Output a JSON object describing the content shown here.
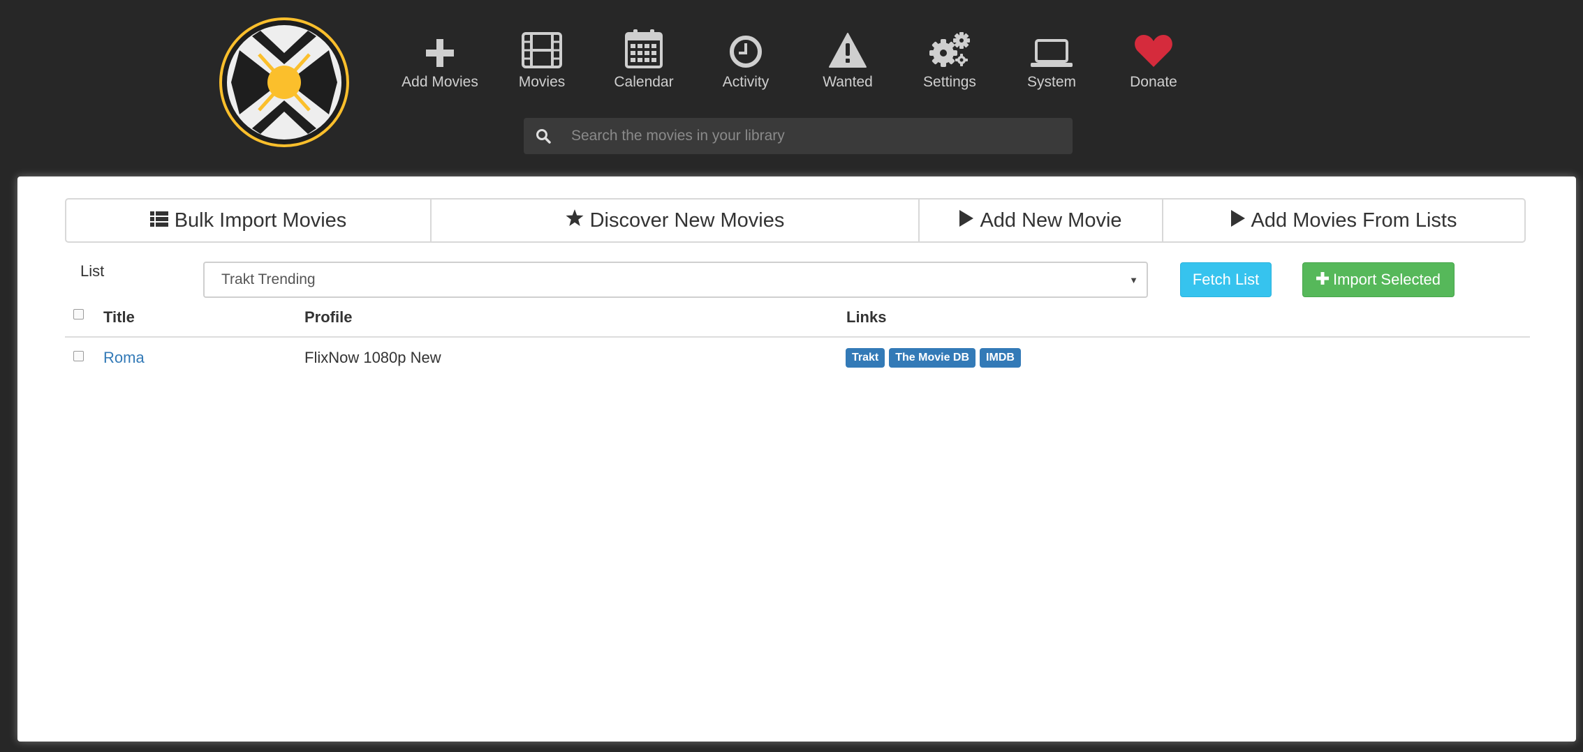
{
  "nav": [
    {
      "label": "Add Movies",
      "icon": "plus-icon"
    },
    {
      "label": "Movies",
      "icon": "film-icon"
    },
    {
      "label": "Calendar",
      "icon": "calendar-icon"
    },
    {
      "label": "Activity",
      "icon": "clock-icon"
    },
    {
      "label": "Wanted",
      "icon": "warning-icon"
    },
    {
      "label": "Settings",
      "icon": "gears-icon"
    },
    {
      "label": "System",
      "icon": "laptop-icon"
    },
    {
      "label": "Donate",
      "icon": "heart-icon"
    }
  ],
  "search": {
    "placeholder": "Search the movies in your library"
  },
  "tabs": [
    {
      "label": "Bulk Import Movies",
      "icon": "list-icon"
    },
    {
      "label": "Discover New Movies",
      "icon": "star-icon"
    },
    {
      "label": "Add New Movie",
      "icon": "play-icon"
    },
    {
      "label": "Add Movies From Lists",
      "icon": "play-icon"
    }
  ],
  "list": {
    "label": "List",
    "selected": "Trakt Trending"
  },
  "buttons": {
    "fetch": "Fetch List",
    "import": "Import Selected"
  },
  "table": {
    "columns": [
      "Title",
      "Profile",
      "Links"
    ],
    "rows": [
      {
        "title": "Roma",
        "profile": "FlixNow 1080p New",
        "links": [
          "Trakt",
          "The Movie DB",
          "IMDB"
        ]
      }
    ]
  },
  "colors": {
    "background": "#272727",
    "logo_accent": "#fbbf2c",
    "link": "#337ab7",
    "fetch_button": "#36c3ee",
    "import_button": "#56b85a",
    "donate_heart": "#d52b3c"
  }
}
